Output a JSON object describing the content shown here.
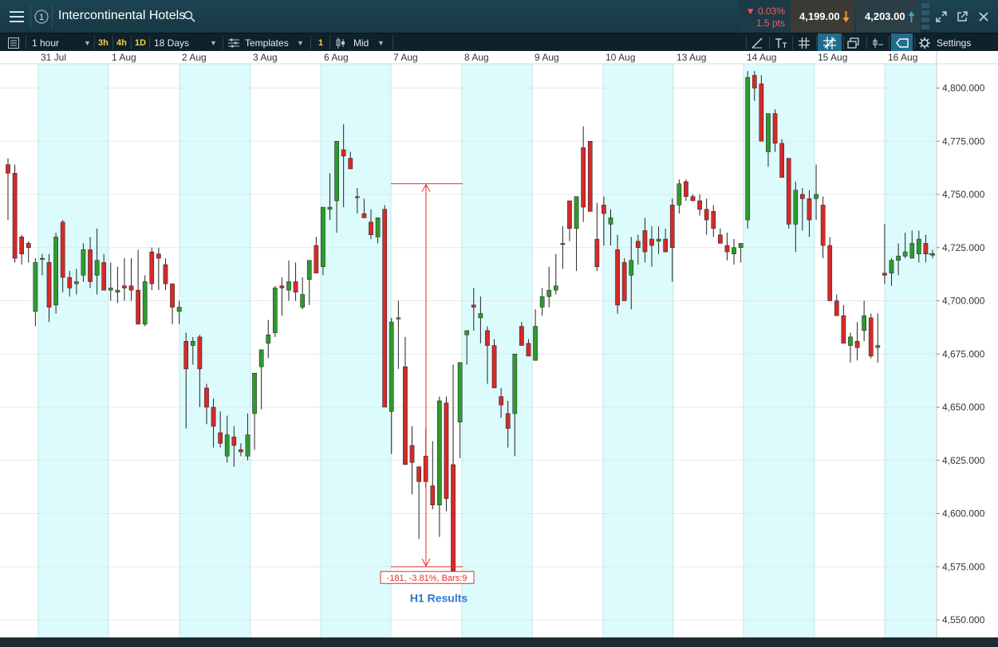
{
  "header": {
    "title": "Intercontinental Hotels",
    "menu_icon": "hamburger-menu-icon",
    "badge_icon": "circled-one-icon",
    "change_pct": "▼ 0.03%",
    "change_pts": "1.5 pts",
    "bid": "4,199.00",
    "ask": "4,203.00",
    "colors": {
      "down": "#ff5454",
      "bid_arrow": "#f0a020",
      "ask_arrow": "#35a6d8"
    }
  },
  "toolbar": {
    "interval": "1 hour",
    "quick": [
      "3h",
      "4h",
      "1D"
    ],
    "range": "18 Days",
    "templates": "Templates",
    "one": "1",
    "price_type": "Mid",
    "settings": "Settings"
  },
  "chart_data": {
    "type": "candlestick",
    "x_labels": [
      "31 Jul",
      "1 Aug",
      "2 Aug",
      "3 Aug",
      "6 Aug",
      "7 Aug",
      "8 Aug",
      "9 Aug",
      "10 Aug",
      "13 Aug",
      "14 Aug",
      "15 Aug",
      "16 Aug"
    ],
    "y_ticks": [
      4550,
      4575,
      4600,
      4625,
      4650,
      4675,
      4700,
      4725,
      4750,
      4775,
      4800
    ],
    "y_tick_labels": [
      "4,550.000",
      "4,575.000",
      "4,600.000",
      "4,625.000",
      "4,650.000",
      "4,675.000",
      "4,700.000",
      "4,725.000",
      "4,750.000",
      "4,775.000",
      "4,800.000"
    ],
    "ylim": [
      4540,
      4815
    ],
    "up_color": "#2e9a2e",
    "down_color": "#d42a2a",
    "candles": [
      [
        4764,
        4767,
        4738,
        4760
      ],
      [
        4760,
        4764,
        4718,
        4720
      ],
      [
        4730,
        4731,
        4717,
        4722
      ],
      [
        4727,
        4728,
        4718,
        4725
      ],
      [
        4695,
        4720,
        4688,
        4718
      ],
      [
        4720,
        4722,
        4712,
        4720
      ],
      [
        4718,
        4722,
        4690,
        4697
      ],
      [
        4698,
        4732,
        4694,
        4730
      ],
      [
        4737,
        4738,
        4704,
        4711
      ],
      [
        4711,
        4714,
        4702,
        4706
      ],
      [
        4708,
        4715,
        4703,
        4709
      ],
      [
        4712,
        4727,
        4709,
        4724
      ],
      [
        4724,
        4730,
        4706,
        4709
      ],
      [
        4712,
        4734,
        4703,
        4719
      ],
      [
        4718,
        4722,
        4706,
        4705
      ],
      [
        4705,
        4718,
        4700,
        4706
      ],
      [
        4704,
        4716,
        4699,
        4705
      ],
      [
        4707,
        4720,
        4700,
        4706
      ],
      [
        4707,
        4720,
        4700,
        4705
      ],
      [
        4705,
        4724,
        4691,
        4689
      ],
      [
        4689,
        4712,
        4688,
        4709
      ],
      [
        4723,
        4725,
        4705,
        4708
      ],
      [
        4722,
        4725,
        4705,
        4720
      ],
      [
        4717,
        4720,
        4705,
        4708
      ],
      [
        4708,
        4708,
        4689,
        4697
      ],
      [
        4695,
        4700,
        4689,
        4697
      ],
      [
        4681,
        4685,
        4640,
        4668
      ],
      [
        4679,
        4683,
        4670,
        4681
      ],
      [
        4683,
        4684,
        4650,
        4668
      ],
      [
        4659,
        4661,
        4642,
        4650
      ],
      [
        4650,
        4654,
        4631,
        4641
      ],
      [
        4638,
        4648,
        4631,
        4633
      ],
      [
        4627,
        4646,
        4624,
        4637
      ],
      [
        4636,
        4641,
        4622,
        4632
      ],
      [
        4630,
        4633,
        4627,
        4629
      ],
      [
        4627,
        4647,
        4625,
        4637
      ],
      [
        4647,
        4661,
        4630,
        4666
      ],
      [
        4669,
        4676,
        4649,
        4677
      ],
      [
        4680,
        4691,
        4673,
        4684
      ],
      [
        4685,
        4707,
        4683,
        4706
      ],
      [
        4707,
        4711,
        4693,
        4706
      ],
      [
        4705,
        4719,
        4700,
        4709
      ],
      [
        4709,
        4718,
        4700,
        4704
      ],
      [
        4697,
        4711,
        4696,
        4703
      ],
      [
        4710,
        4718,
        4698,
        4719
      ],
      [
        4726,
        4730,
        4716,
        4713
      ],
      [
        4716,
        4740,
        4712,
        4744
      ],
      [
        4743,
        4760,
        4738,
        4744
      ],
      [
        4747,
        4770,
        4732,
        4775
      ],
      [
        4771,
        4783,
        4744,
        4768
      ],
      [
        4767,
        4770,
        4765,
        4762
      ],
      [
        4749,
        4753,
        4741,
        4749
      ],
      [
        4741,
        4748,
        4741,
        4739
      ],
      [
        4737,
        4743,
        4729,
        4731
      ],
      [
        4730,
        4737,
        4727,
        4739
      ],
      [
        4743,
        4745,
        4688,
        4650
      ],
      [
        4648,
        4692,
        4628,
        4690
      ],
      [
        4692,
        4700,
        4668,
        4692
      ],
      [
        4669,
        4683,
        4661,
        4623
      ],
      [
        4632,
        4641,
        4609,
        4624
      ],
      [
        4622,
        4620,
        4588,
        4615
      ],
      [
        4627,
        4640,
        4612,
        4615
      ],
      [
        4613,
        4634,
        4602,
        4604
      ],
      [
        4604,
        4655,
        4589,
        4653
      ],
      [
        4652,
        4655,
        4601,
        4607
      ],
      [
        4623,
        4670,
        4574,
        4572
      ],
      [
        4643,
        4660,
        4626,
        4671
      ],
      [
        4684,
        4686,
        4670,
        4686
      ],
      [
        4698,
        4706,
        4686,
        4697
      ],
      [
        4692,
        4702,
        4680,
        4694
      ],
      [
        4686,
        4688,
        4661,
        4679
      ],
      [
        4679,
        4682,
        4660,
        4659
      ],
      [
        4655,
        4659,
        4645,
        4651
      ],
      [
        4647,
        4653,
        4631,
        4640
      ],
      [
        4647,
        4670,
        4627,
        4675
      ],
      [
        4688,
        4690,
        4680,
        4679
      ],
      [
        4680,
        4682,
        4674,
        4674
      ],
      [
        4672,
        4696,
        4673,
        4688
      ],
      [
        4697,
        4706,
        4693,
        4702
      ],
      [
        4702,
        4716,
        4697,
        4705
      ],
      [
        4705,
        4722,
        4703,
        4707
      ],
      [
        4727,
        4735,
        4715,
        4727
      ],
      [
        4747,
        4742,
        4728,
        4734
      ],
      [
        4734,
        4749,
        4714,
        4749
      ],
      [
        4772,
        4782,
        4737,
        4744
      ],
      [
        4775,
        4775,
        4742,
        4742
      ],
      [
        4729,
        4746,
        4714,
        4716
      ],
      [
        4745,
        4749,
        4726,
        4741
      ],
      [
        4736,
        4743,
        4726,
        4739
      ],
      [
        4724,
        4731,
        4694,
        4698
      ],
      [
        4718,
        4720,
        4700,
        4700
      ],
      [
        4712,
        4730,
        4696,
        4719
      ],
      [
        4728,
        4731,
        4717,
        4725
      ],
      [
        4733,
        4739,
        4718,
        4723
      ],
      [
        4729,
        4735,
        4716,
        4726
      ],
      [
        4728,
        4735,
        4722,
        4729
      ],
      [
        4729,
        4734,
        4724,
        4723
      ],
      [
        4745,
        4748,
        4709,
        4725
      ],
      [
        4745,
        4757,
        4741,
        4755
      ],
      [
        4756,
        4757,
        4747,
        4749
      ],
      [
        4749,
        4750,
        4747,
        4747
      ],
      [
        4747,
        4750,
        4740,
        4743
      ],
      [
        4743,
        4748,
        4731,
        4738
      ],
      [
        4742,
        4745,
        4730,
        4734
      ],
      [
        4731,
        4734,
        4728,
        4727
      ],
      [
        4726,
        4732,
        4719,
        4723
      ],
      [
        4722,
        4729,
        4717,
        4725
      ],
      [
        4725,
        4727,
        4718,
        4727
      ],
      [
        4738,
        4808,
        4734,
        4805
      ],
      [
        4806,
        4808,
        4794,
        4800
      ],
      [
        4802,
        4806,
        4775,
        4775
      ],
      [
        4770,
        4778,
        4763,
        4788
      ],
      [
        4788,
        4790,
        4770,
        4774
      ],
      [
        4774,
        4776,
        4767,
        4758
      ],
      [
        4767,
        4766,
        4734,
        4736
      ],
      [
        4736,
        4756,
        4723,
        4752
      ],
      [
        4750,
        4753,
        4733,
        4748
      ],
      [
        4748,
        4752,
        4730,
        4738
      ],
      [
        4748,
        4764,
        4738,
        4750
      ],
      [
        4745,
        4749,
        4720,
        4726
      ],
      [
        4726,
        4730,
        4712,
        4700
      ],
      [
        4700,
        4703,
        4693,
        4693
      ],
      [
        4693,
        4698,
        4683,
        4680
      ],
      [
        4679,
        4685,
        4671,
        4683
      ],
      [
        4681,
        4690,
        4672,
        4678
      ],
      [
        4686,
        4700,
        4681,
        4693
      ],
      [
        4692,
        4694,
        4673,
        4674
      ],
      [
        4678,
        4694,
        4671,
        4679
      ],
      [
        4713,
        4736,
        4708,
        4712
      ],
      [
        4713,
        4720,
        4707,
        4719
      ],
      [
        4719,
        4727,
        4712,
        4721
      ],
      [
        4721,
        4732,
        4720,
        4723
      ],
      [
        4720,
        4733,
        4720,
        4727
      ],
      [
        4722,
        4733,
        4718,
        4729
      ],
      [
        4727,
        4731,
        4718,
        4722
      ],
      [
        4722,
        4724,
        4720,
        4722
      ]
    ],
    "annotations": {
      "measure_label": "-181, -3.81%, Bars:9",
      "event_label": "H1 Results"
    }
  }
}
